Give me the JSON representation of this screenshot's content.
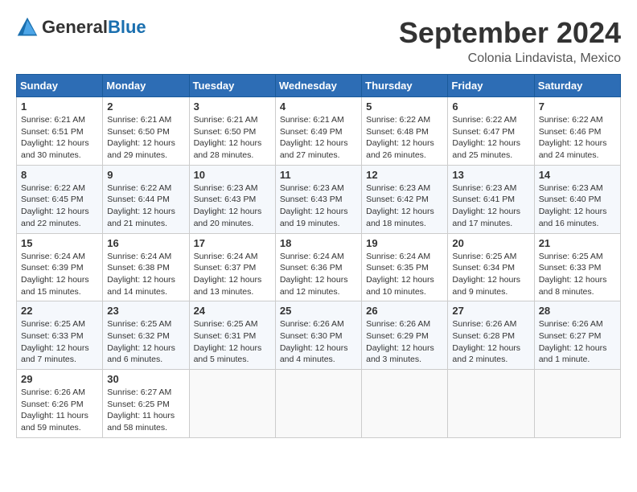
{
  "header": {
    "logo_general": "General",
    "logo_blue": "Blue",
    "month_title": "September 2024",
    "location": "Colonia Lindavista, Mexico"
  },
  "days_of_week": [
    "Sunday",
    "Monday",
    "Tuesday",
    "Wednesday",
    "Thursday",
    "Friday",
    "Saturday"
  ],
  "weeks": [
    [
      {
        "day": "1",
        "sunrise": "6:21 AM",
        "sunset": "6:51 PM",
        "daylight": "12 hours and 30 minutes."
      },
      {
        "day": "2",
        "sunrise": "6:21 AM",
        "sunset": "6:50 PM",
        "daylight": "12 hours and 29 minutes."
      },
      {
        "day": "3",
        "sunrise": "6:21 AM",
        "sunset": "6:50 PM",
        "daylight": "12 hours and 28 minutes."
      },
      {
        "day": "4",
        "sunrise": "6:21 AM",
        "sunset": "6:49 PM",
        "daylight": "12 hours and 27 minutes."
      },
      {
        "day": "5",
        "sunrise": "6:22 AM",
        "sunset": "6:48 PM",
        "daylight": "12 hours and 26 minutes."
      },
      {
        "day": "6",
        "sunrise": "6:22 AM",
        "sunset": "6:47 PM",
        "daylight": "12 hours and 25 minutes."
      },
      {
        "day": "7",
        "sunrise": "6:22 AM",
        "sunset": "6:46 PM",
        "daylight": "12 hours and 24 minutes."
      }
    ],
    [
      {
        "day": "8",
        "sunrise": "6:22 AM",
        "sunset": "6:45 PM",
        "daylight": "12 hours and 22 minutes."
      },
      {
        "day": "9",
        "sunrise": "6:22 AM",
        "sunset": "6:44 PM",
        "daylight": "12 hours and 21 minutes."
      },
      {
        "day": "10",
        "sunrise": "6:23 AM",
        "sunset": "6:43 PM",
        "daylight": "12 hours and 20 minutes."
      },
      {
        "day": "11",
        "sunrise": "6:23 AM",
        "sunset": "6:43 PM",
        "daylight": "12 hours and 19 minutes."
      },
      {
        "day": "12",
        "sunrise": "6:23 AM",
        "sunset": "6:42 PM",
        "daylight": "12 hours and 18 minutes."
      },
      {
        "day": "13",
        "sunrise": "6:23 AM",
        "sunset": "6:41 PM",
        "daylight": "12 hours and 17 minutes."
      },
      {
        "day": "14",
        "sunrise": "6:23 AM",
        "sunset": "6:40 PM",
        "daylight": "12 hours and 16 minutes."
      }
    ],
    [
      {
        "day": "15",
        "sunrise": "6:24 AM",
        "sunset": "6:39 PM",
        "daylight": "12 hours and 15 minutes."
      },
      {
        "day": "16",
        "sunrise": "6:24 AM",
        "sunset": "6:38 PM",
        "daylight": "12 hours and 14 minutes."
      },
      {
        "day": "17",
        "sunrise": "6:24 AM",
        "sunset": "6:37 PM",
        "daylight": "12 hours and 13 minutes."
      },
      {
        "day": "18",
        "sunrise": "6:24 AM",
        "sunset": "6:36 PM",
        "daylight": "12 hours and 12 minutes."
      },
      {
        "day": "19",
        "sunrise": "6:24 AM",
        "sunset": "6:35 PM",
        "daylight": "12 hours and 10 minutes."
      },
      {
        "day": "20",
        "sunrise": "6:25 AM",
        "sunset": "6:34 PM",
        "daylight": "12 hours and 9 minutes."
      },
      {
        "day": "21",
        "sunrise": "6:25 AM",
        "sunset": "6:33 PM",
        "daylight": "12 hours and 8 minutes."
      }
    ],
    [
      {
        "day": "22",
        "sunrise": "6:25 AM",
        "sunset": "6:33 PM",
        "daylight": "12 hours and 7 minutes."
      },
      {
        "day": "23",
        "sunrise": "6:25 AM",
        "sunset": "6:32 PM",
        "daylight": "12 hours and 6 minutes."
      },
      {
        "day": "24",
        "sunrise": "6:25 AM",
        "sunset": "6:31 PM",
        "daylight": "12 hours and 5 minutes."
      },
      {
        "day": "25",
        "sunrise": "6:26 AM",
        "sunset": "6:30 PM",
        "daylight": "12 hours and 4 minutes."
      },
      {
        "day": "26",
        "sunrise": "6:26 AM",
        "sunset": "6:29 PM",
        "daylight": "12 hours and 3 minutes."
      },
      {
        "day": "27",
        "sunrise": "6:26 AM",
        "sunset": "6:28 PM",
        "daylight": "12 hours and 2 minutes."
      },
      {
        "day": "28",
        "sunrise": "6:26 AM",
        "sunset": "6:27 PM",
        "daylight": "12 hours and 1 minute."
      }
    ],
    [
      {
        "day": "29",
        "sunrise": "6:26 AM",
        "sunset": "6:26 PM",
        "daylight": "11 hours and 59 minutes."
      },
      {
        "day": "30",
        "sunrise": "6:27 AM",
        "sunset": "6:25 PM",
        "daylight": "11 hours and 58 minutes."
      },
      null,
      null,
      null,
      null,
      null
    ]
  ]
}
